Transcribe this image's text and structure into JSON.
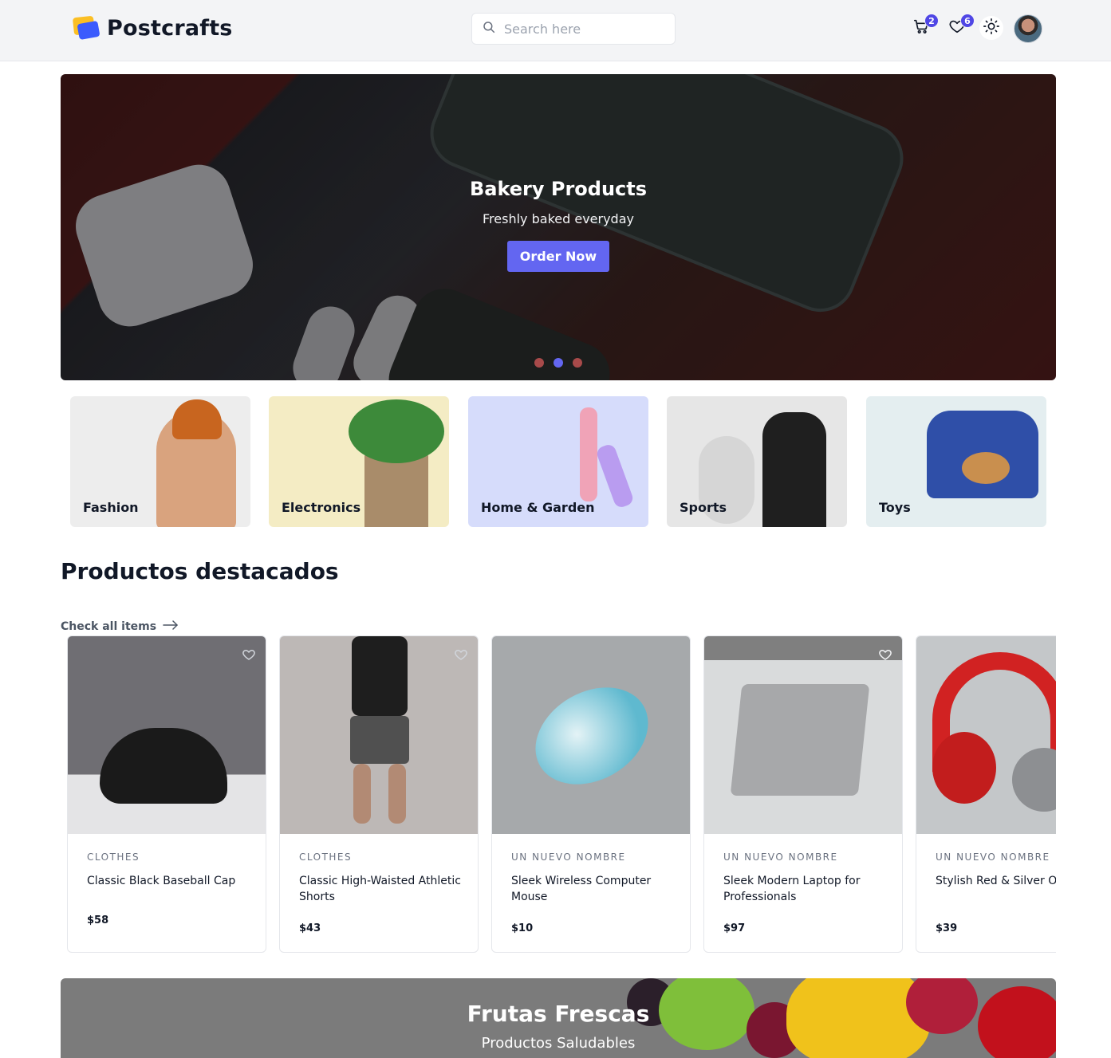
{
  "brand": {
    "name": "Postcrafts"
  },
  "search": {
    "placeholder": "Search here"
  },
  "header": {
    "cart_count": "2",
    "wishlist_count": "6"
  },
  "hero": {
    "title": "Bakery Products",
    "subtitle": "Freshly baked everyday",
    "button": "Order Now",
    "slides": 3,
    "active_slide": 2
  },
  "categories": [
    {
      "label": "Fashion",
      "bg": "#ededed"
    },
    {
      "label": "Electronics",
      "bg": "#f4ecc4"
    },
    {
      "label": "Home & Garden",
      "bg": "#d6dcfb"
    },
    {
      "label": "Sports",
      "bg": "#e6e6e6"
    },
    {
      "label": "Toys",
      "bg": "#e4eef0"
    }
  ],
  "featured": {
    "title": "Productos destacados",
    "check_all": "Check all items",
    "products": [
      {
        "category": "Clothes",
        "name": "Classic Black Baseball Cap",
        "price": "$58"
      },
      {
        "category": "Clothes",
        "name": "Classic High-Waisted Athletic Shorts",
        "price": "$43"
      },
      {
        "category": "Un nuevo nombre",
        "name": "Sleek Wireless Computer Mouse",
        "price": "$10"
      },
      {
        "category": "Un nuevo nombre",
        "name": "Sleek Modern Laptop for Professionals",
        "price": "$97"
      },
      {
        "category": "Un nuevo nombre",
        "name": "Stylish Red & Silver Over-Ear Headphones",
        "price": "$39"
      }
    ]
  },
  "promo": {
    "title": "Frutas Frescas",
    "subtitle": "Productos Saludables"
  },
  "colors": {
    "accent": "#6366f1",
    "badge": "#4f46e5",
    "header_bg": "#f3f4f6"
  }
}
